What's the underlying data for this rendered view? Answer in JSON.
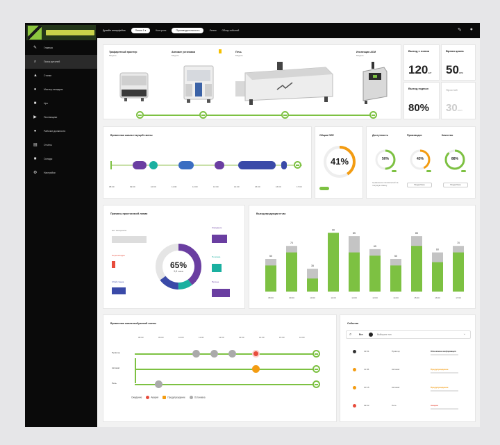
{
  "sidebar": {
    "items": [
      {
        "label": "Главная",
        "icon": "edit-icon"
      },
      {
        "label": "Поиск деталей",
        "icon": "search-icon"
      },
      {
        "label": "Станки",
        "icon": "factory-icon"
      },
      {
        "label": "Мастер-наладчик",
        "icon": "user-icon"
      },
      {
        "label": "Цех",
        "icon": "building-icon"
      },
      {
        "label": "Поставщики",
        "icon": "truck-icon"
      },
      {
        "label": "Рабочие должности",
        "icon": "people-icon"
      },
      {
        "label": "Отчёты",
        "icon": "document-icon"
      },
      {
        "label": "Склады",
        "icon": "box-icon"
      },
      {
        "label": "Настройки",
        "icon": "gear-icon"
      }
    ],
    "active_index": 1
  },
  "topbar": {
    "items": [
      {
        "label": "Дизайн интерфейса",
        "pill": false
      },
      {
        "label": "Линия 1 ▾",
        "pill": true
      },
      {
        "label": "Контроль",
        "pill": false
      },
      {
        "label": "Производительность",
        "pill": true
      },
      {
        "label": "Линия",
        "pill": false
      },
      {
        "label": "Обзор событий",
        "pill": false
      }
    ]
  },
  "line": {
    "machines": [
      {
        "name": "Трафаретный принтер",
        "sub": "Модель"
      },
      {
        "name": "Автомат установки",
        "sub": "Модель"
      },
      {
        "name": "Печь",
        "sub": "Модель"
      },
      {
        "name": "Инспекция АОИ",
        "sub": "Модель"
      }
    ]
  },
  "stats": [
    {
      "label": "Выход с линии",
      "value": "120",
      "unit": "шт"
    },
    {
      "label": "Время цикла",
      "value": "50",
      "unit": "сек"
    },
    {
      "label": "Выход годных",
      "value": "80%",
      "unit": ""
    },
    {
      "label": "Простой",
      "value": "30",
      "unit": "мин"
    }
  ],
  "timeline1": {
    "title": "Временная шкала текущей смены",
    "ticks": [
      "08:00",
      "09:00",
      "10:00",
      "11:00",
      "12:00",
      "13:00",
      "14:00",
      "15:00",
      "16:00",
      "17:00"
    ]
  },
  "oee": {
    "title": "Общая ОЕЕ",
    "value": "41%"
  },
  "gauges": {
    "items": [
      {
        "title": "Доступность",
        "value": "50%",
        "color": "#7dc142"
      },
      {
        "title": "Производит.",
        "value": "43%",
        "color": "#f39c12"
      },
      {
        "title": "Качество",
        "value": "88%",
        "color": "#7dc142"
      }
    ],
    "buttons": [
      "Подробнее",
      "Подробнее"
    ],
    "note": "Сравнение показателей за текущую смену"
  },
  "downtime": {
    "title": "Причины простоя всей линии",
    "center_value": "65%",
    "center_sub": "5,8 часа",
    "labels": [
      "Нет материала",
      "Переналадка",
      "Сбой станка",
      "Ожидание",
      "Поломка",
      "Прочее"
    ]
  },
  "chart_data": {
    "type": "bar",
    "title": "Выход продукции в час",
    "categories": [
      "08:00",
      "09:00",
      "10:00",
      "11:00",
      "12:00",
      "13:00",
      "14:00",
      "15:00",
      "16:00",
      "17:00"
    ],
    "series": [
      {
        "values": [
          40,
          60,
          20,
          90,
          60,
          55,
          40,
          70,
          45,
          60
        ]
      },
      {
        "values": [
          50,
          70,
          35,
          90,
          85,
          65,
          50,
          85,
          60,
          70
        ]
      }
    ],
    "data_labels": [
      "50",
      "70",
      "35",
      "90",
      "85",
      "65",
      "50",
      "85",
      "60",
      "70"
    ]
  },
  "timeline2": {
    "title": "Временная шкала выбранной смены",
    "rows": [
      "Принтер",
      "Автомат",
      "Печь"
    ],
    "ticks": [
      "08:00",
      "09:00",
      "10:00",
      "11:00",
      "12:00",
      "13:00",
      "14:00",
      "15:00",
      "16:00"
    ],
    "legend": [
      "Ожидание",
      "Авария",
      "Предупреждение",
      "Остановка"
    ]
  },
  "events": {
    "title": "События",
    "filter_all": "Все",
    "filter_tag": "Выберите тип",
    "rows": [
      {
        "time": "12:01",
        "src": "Принтер",
        "msg": "Обновлена информация",
        "color": "#333"
      },
      {
        "time": "11:36",
        "src": "Автомат",
        "msg": "Предупреждение",
        "color": "#f39c12"
      },
      {
        "time": "10:15",
        "src": "Автомат",
        "msg": "Предупреждение",
        "color": "#f39c12"
      },
      {
        "time": "09:02",
        "src": "Печь",
        "msg": "Авария",
        "color": "#e74c3c"
      }
    ]
  }
}
